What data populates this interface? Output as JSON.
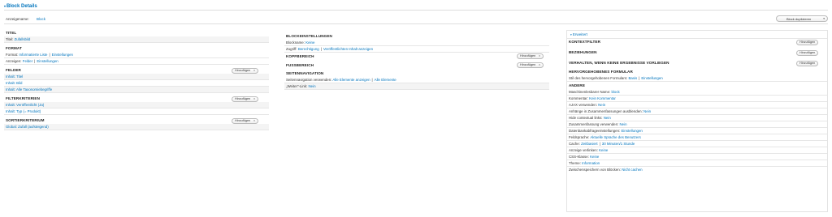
{
  "header": {
    "title": "Block Details"
  },
  "display_name": {
    "label": "Anzeigename:",
    "value": "Block"
  },
  "duplicate_button": {
    "label": "Block duplizieren"
  },
  "column1": {
    "titel": {
      "title": "TITEL",
      "label": "Titel:",
      "value": "Zufallsbild"
    },
    "format": {
      "title": "FORMAT",
      "format_label": "Format:",
      "format_value": "Informatierte Liste",
      "format_settings": "Einstellungen",
      "show_label": "Anzeigen:",
      "show_value": "Felder",
      "show_settings": "Einstellungen"
    },
    "felder": {
      "title": "FELDER",
      "button": "Hinzufügen",
      "items": [
        "Inhalt: Titel",
        "Inhalt: Bild",
        "Inhalt: Alle Taxonomiebegriffe"
      ]
    },
    "filter": {
      "title": "FILTERKRITERIEN",
      "button": "Hinzufügen",
      "items": [
        "Inhalt: Veröffentlicht (Ja)",
        "Inhalt: Typ (= Produkt)"
      ]
    },
    "sort": {
      "title": "SORTIERKRITERIUM",
      "button": "Hinzufügen",
      "items": [
        "Global: Zufall (aufsteigend)"
      ]
    }
  },
  "column2": {
    "block_settings": {
      "title": "BLOCKEINSTELLUNGEN",
      "name_label": "Blockname:",
      "name_value": "Keine",
      "access_label": "Zugriff:",
      "access_value": "Berechtigung",
      "access_extra": "Veröffentlichten Inhalt anzeigen"
    },
    "header_area": {
      "title": "KOPFBEREICH",
      "button": "Hinzufügen"
    },
    "footer_area": {
      "title": "FUSSBEREICH",
      "button": "Hinzufügen"
    },
    "pager": {
      "title": "SEITENNAVIGATION",
      "use_label": "Seitennavigation verwenden:",
      "use_value": "Alle Elemente anzeigen",
      "use_extra": "Alle Elemente",
      "more_label": "„Weiter“-Link:",
      "more_value": "Nein"
    }
  },
  "column3": {
    "toggle": "Erweitert",
    "context": {
      "title": "KONTEXTFILTER",
      "button": "Hinzufügen"
    },
    "relations": {
      "title": "BEZIEHUNGEN",
      "button": "Hinzufügen"
    },
    "no_results": {
      "title": "VERHALTEN, WENN KEINE ERGEBNISSE VORLIEGEN",
      "button": "Hinzufügen"
    },
    "exposed_form": {
      "title": "HERVORGEHOBENES FORMULAR",
      "label": "Stil des hervorgehobenen Formulars:",
      "value": "Basis",
      "settings": "Einstellungen"
    },
    "other": {
      "title": "ANDERE",
      "rows": [
        {
          "label": "Maschinenlesbarer Name:",
          "value": "block"
        },
        {
          "label": "Kommentar:",
          "value": "Kein Kommentar"
        },
        {
          "label": "AJAX verwenden:",
          "value": "Nein"
        },
        {
          "label": "Anhänge in Zusammenfassungen ausblenden:",
          "value": "Nein"
        },
        {
          "label": "Hide contextual links:",
          "value": "Nein"
        },
        {
          "label": "Zusammenfassung verwenden:",
          "value": "Nein"
        },
        {
          "label": "Datenbankabfrageeinstellungen:",
          "value": "Einstellungen"
        },
        {
          "label": "Feldsprache:",
          "value": "Aktuelle Sprache des Benutzers"
        },
        {
          "label": "Cache:",
          "value": "Zeitbasiert",
          "extra": "30 Minuten/1 Stunde"
        },
        {
          "label": "Anzeige verlinken:",
          "value": "Keine"
        },
        {
          "label": "CSS-Klasse:",
          "value": "Keine"
        },
        {
          "label": "Theme:",
          "value": "Information"
        },
        {
          "label": "Zwischenspeichern von Blöcken:",
          "value": "Nicht cachen"
        }
      ]
    }
  }
}
